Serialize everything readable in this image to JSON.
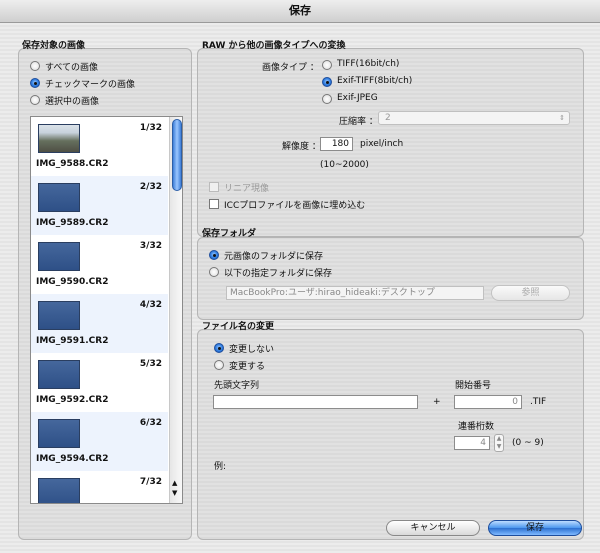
{
  "window": {
    "title": "保存"
  },
  "targets": {
    "title": "保存対象の画像",
    "options": [
      "すべての画像",
      "チェックマークの画像",
      "選択中の画像"
    ],
    "selected_index": 1,
    "images": [
      {
        "counter": "1/32",
        "name": "IMG_9588.CR2"
      },
      {
        "counter": "2/32",
        "name": "IMG_9589.CR2"
      },
      {
        "counter": "3/32",
        "name": "IMG_9590.CR2"
      },
      {
        "counter": "4/32",
        "name": "IMG_9591.CR2"
      },
      {
        "counter": "5/32",
        "name": "IMG_9592.CR2"
      },
      {
        "counter": "6/32",
        "name": "IMG_9594.CR2"
      },
      {
        "counter": "7/32",
        "name": ""
      }
    ]
  },
  "conversion": {
    "title": "RAW から他の画像タイプへの変換",
    "image_type_label": "画像タイプ ：",
    "types": [
      "TIFF(16bit/ch)",
      "Exif-TIFF(8bit/ch)",
      "Exif-JPEG"
    ],
    "selected_type_index": 1,
    "compression_label": "圧縮率 ：",
    "compression_value": "2",
    "resolution_label": "解像度 ：",
    "resolution_value": "180",
    "resolution_unit": "pixel/inch",
    "resolution_range": "(10~2000)",
    "linear_label": "リニア現像",
    "icc_label": "ICCプロファイルを画像に埋め込む"
  },
  "folder": {
    "title": "保存フォルダ",
    "options": [
      "元画像のフォルダに保存",
      "以下の指定フォルダに保存"
    ],
    "selected_index": 0,
    "path_value": "MacBookPro:ユーザ:hirao_hideaki:デスクトップ",
    "browse_label": "参照"
  },
  "rename": {
    "title": "ファイル名の変更",
    "options": [
      "変更しない",
      "変更する"
    ],
    "selected_index": 0,
    "prefix_label": "先頭文字列",
    "prefix_value": "",
    "plus": "+",
    "start_label": "開始番号",
    "start_value": "0",
    "extension": ".TIF",
    "digits_label": "連番桁数",
    "digits_value": "4",
    "digits_range": "(0 ~ 9)",
    "example_label": "例:"
  },
  "buttons": {
    "cancel": "キャンセル",
    "save": "保存"
  }
}
